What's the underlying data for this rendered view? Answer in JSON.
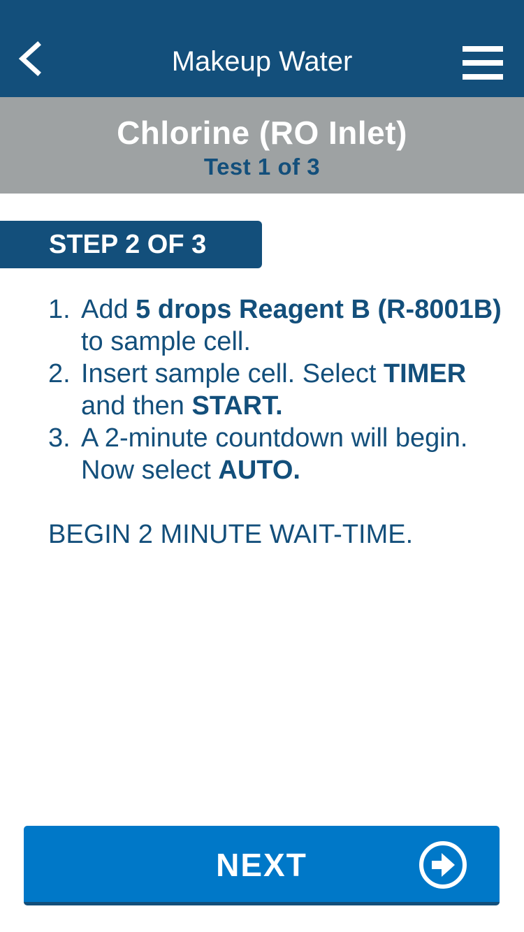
{
  "header": {
    "title": "Makeup Water",
    "back_icon": "chevron-left-icon",
    "menu_icon": "hamburger-menu-icon"
  },
  "test": {
    "title": "Chlorine (RO Inlet)",
    "subtitle": "Test 1 of 3"
  },
  "step": {
    "label": "STEP 2 OF 3"
  },
  "instructions": [
    {
      "number": "1.",
      "parts": [
        {
          "text": "Add ",
          "bold": false
        },
        {
          "text": "5 drops Reagent B (R-8001B)",
          "bold": true
        },
        {
          "text": " to sample cell.",
          "bold": false
        }
      ]
    },
    {
      "number": "2.",
      "parts": [
        {
          "text": "Insert sample cell. Select ",
          "bold": false
        },
        {
          "text": "TIMER",
          "bold": true
        },
        {
          "text": " and then ",
          "bold": false
        },
        {
          "text": "START.",
          "bold": true
        }
      ]
    },
    {
      "number": "3.",
      "parts": [
        {
          "text": "A 2-minute countdown will begin. Now select ",
          "bold": false
        },
        {
          "text": "AUTO.",
          "bold": true
        }
      ]
    }
  ],
  "wait_text": "BEGIN 2 MINUTE WAIT-TIME.",
  "next_button": {
    "label": "NEXT",
    "icon": "arrow-right-circle-icon"
  },
  "colors": {
    "header_bg": "#134f7b",
    "subheader_bg": "#9ea2a3",
    "text_primary": "#134f7b",
    "button_bg": "#0078c8"
  }
}
